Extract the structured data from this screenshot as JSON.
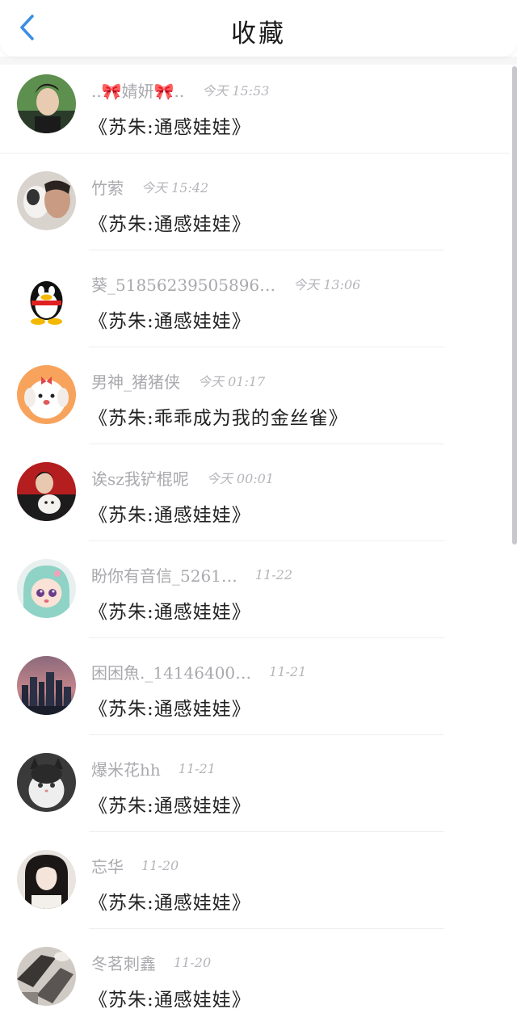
{
  "header": {
    "title": "收藏",
    "back_icon": "chevron-left-icon",
    "accent_color": "#3a8fe3"
  },
  "items": [
    {
      "name": "..🎀婧妍🎀..",
      "time": "今天 15:53",
      "message": "《苏朱:通感娃娃》",
      "avatar": "young-man-photo"
    },
    {
      "name": "竹萦",
      "time": "今天 15:42",
      "message": "《苏朱:通感娃娃》",
      "avatar": "man-with-dog-photo"
    },
    {
      "name": "葵_51856239505896…",
      "time": "今天 13:06",
      "message": "《苏朱:通感娃娃》",
      "avatar": "qq-penguin"
    },
    {
      "name": "男神_猪猪侠",
      "time": "今天 01:17",
      "message": "《苏朱:乖乖成为我的金丝雀》",
      "avatar": "cartoon-puppy"
    },
    {
      "name": "诶sz我铲棍呢",
      "time": "今天 00:01",
      "message": "《苏朱:通感娃娃》",
      "avatar": "man-with-white-dog-photo"
    },
    {
      "name": "盼你有音信_5261…",
      "time": "11-22",
      "message": "《苏朱:通感娃娃》",
      "avatar": "anime-girl"
    },
    {
      "name": "困困魚._14146400…",
      "time": "11-21",
      "message": "《苏朱:通感娃娃》",
      "avatar": "city-skyline-photo"
    },
    {
      "name": "爆米花hh",
      "time": "11-21",
      "message": "《苏朱:通感娃娃》",
      "avatar": "cat-photo"
    },
    {
      "name": "忘华",
      "time": "11-20",
      "message": "《苏朱:通感娃娃》",
      "avatar": "girl-selfie-photo"
    },
    {
      "name": "冬茗刺鑫",
      "time": "11-20",
      "message": "《苏朱:通感娃娃》",
      "avatar": "monochrome-photo"
    }
  ]
}
